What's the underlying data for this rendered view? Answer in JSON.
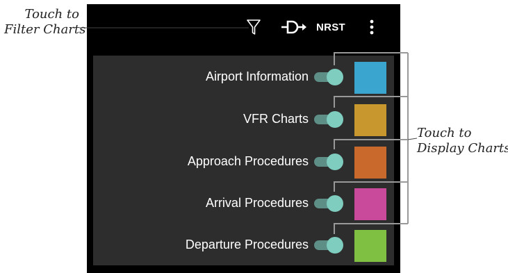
{
  "callouts": {
    "filter": [
      "Touch to",
      "Filter Charts"
    ],
    "display": [
      "Touch to",
      "Display Charts"
    ]
  },
  "toolbar": {
    "filter_icon": "funnel-icon",
    "direct_to_icon": "direct-to-icon",
    "nrst_label": "NRST",
    "menu_icon": "more-vert-icon"
  },
  "chart_types": [
    {
      "label": "Airport Information",
      "enabled": true,
      "color": "#3aa6d0"
    },
    {
      "label": "VFR Charts",
      "enabled": true,
      "color": "#c8982e"
    },
    {
      "label": "Approach Procedures",
      "enabled": true,
      "color": "#c96a2c"
    },
    {
      "label": "Arrival Procedures",
      "enabled": true,
      "color": "#c94a9a"
    },
    {
      "label": "Departure Procedures",
      "enabled": true,
      "color": "#7fc043"
    }
  ],
  "colors": {
    "toggle_track": "#5d8f87",
    "toggle_thumb": "#7ecdbf",
    "panel": "#2d2d2d"
  }
}
